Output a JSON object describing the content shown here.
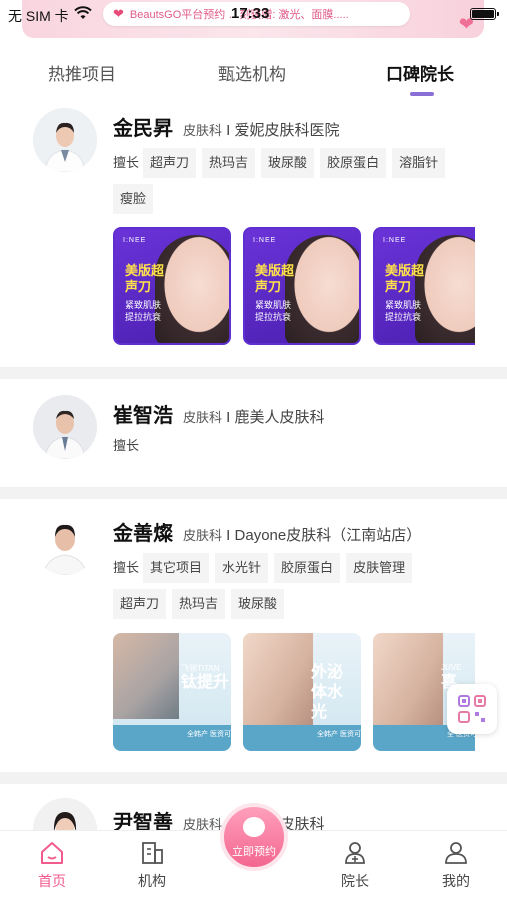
{
  "status": {
    "carrier": "无 SIM 卡",
    "time": "17:33",
    "notice": "BeautsGO平台预约 …刻获赠: 激光、面膜....."
  },
  "tabs": [
    {
      "label": "热推项目"
    },
    {
      "label": "甄选机构"
    },
    {
      "label": "口碑院长"
    }
  ],
  "doctors": [
    {
      "name": "金民昇",
      "dept": "皮肤科",
      "hospital": "爱妮皮肤科医院",
      "skill_label": "擅长",
      "skills": [
        "超声刀",
        "热玛吉",
        "玻尿酸",
        "胶原蛋白",
        "溶脂针",
        "瘦脸"
      ],
      "promo": {
        "logo": "I:NEE",
        "title": "美版超声刀",
        "sub": "紧致肌肤提拉抗衰"
      }
    },
    {
      "name": "崔智浩",
      "dept": "皮肤科",
      "hospital": "鹿美人皮肤科",
      "skill_label": "擅长",
      "skills": []
    },
    {
      "name": "金善燦",
      "dept": "皮肤科",
      "hospital": "Dayone皮肤科（江南站店）",
      "skill_label": "擅长",
      "skills": [
        "其它项目",
        "水光针",
        "胶原蛋白",
        "皮肤管理",
        "超声刀",
        "热玛吉",
        "玻尿酸"
      ],
      "thumbs": [
        {
          "small": "飞顿TITAN",
          "caption": "钛提升",
          "foot": "全韩产 医资可查 透明"
        },
        {
          "small": "",
          "caption": "外泌体水光",
          "foot": "全韩产 医资可查 透明"
        },
        {
          "small": "JUVE",
          "caption": "喜",
          "foot": "全 医资可查 透"
        }
      ]
    },
    {
      "name": "尹智善",
      "dept": "皮肤科",
      "hospital": "鹿美人皮肤科"
    }
  ],
  "bottom_nav": {
    "home": "首页",
    "clinic": "机构",
    "book": "立即预约",
    "director": "院长",
    "mine": "我的"
  },
  "colors": {
    "accent": "#f25c8d",
    "tab_indicator": "#8a6fd6",
    "promo_purple": "#5f2fd0"
  }
}
